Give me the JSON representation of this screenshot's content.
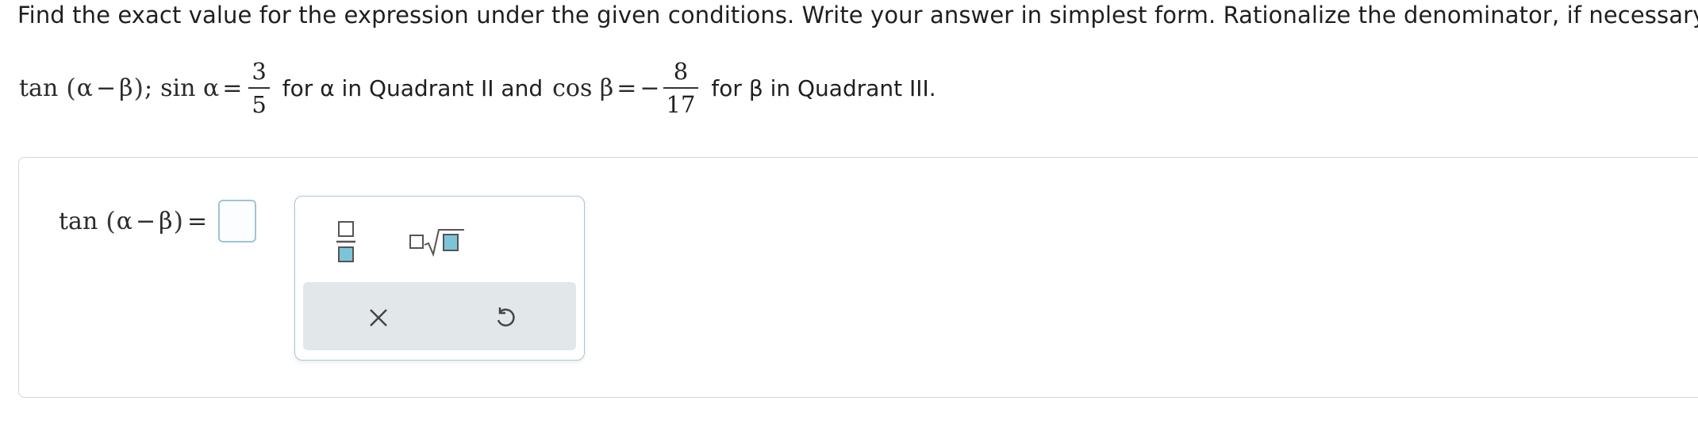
{
  "instructions": "Find the exact value for the expression under the given conditions. Write your answer in simplest form. Rationalize the denominator, if necessary.",
  "problem": {
    "expr_func": "tan",
    "open_paren": "(",
    "alpha": "α",
    "minus": "−",
    "beta": "β",
    "close_paren": ")",
    "separator": ";",
    "sin_label": "sin α",
    "equals": "=",
    "sin_num": "3",
    "sin_den": "5",
    "alpha_condition": "for α in Quadrant II and",
    "cos_label": "cos β",
    "cos_sign": "−",
    "cos_num": "8",
    "cos_den": "17",
    "beta_condition": "for β in Quadrant III."
  },
  "answer": {
    "lhs_func": "tan",
    "open_paren": "(",
    "alpha": "α",
    "minus": "−",
    "beta": "β",
    "close_paren": ")",
    "equals": "=",
    "value": ""
  },
  "toolbox": {
    "buttons": [
      "fraction-template",
      "nth-root-template",
      "clear",
      "undo"
    ],
    "accent": "#7ec4d8",
    "border": "#a9c5d3",
    "tray_color": "#e2e7ea"
  }
}
